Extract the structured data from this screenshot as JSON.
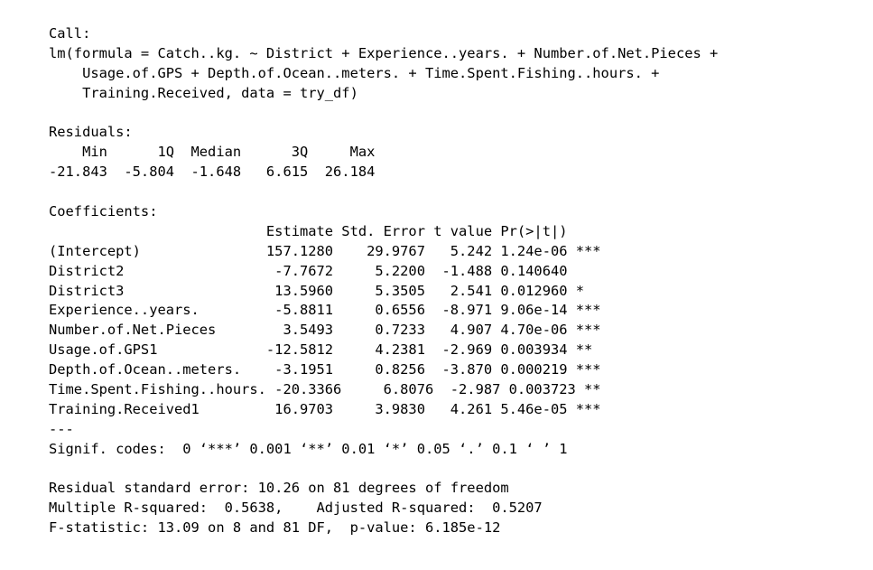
{
  "call": {
    "header": "Call:",
    "lines": [
      "lm(formula = Catch..kg. ~ District + Experience..years. + Number.of.Net.Pieces +",
      "    Usage.of.GPS + Depth.of.Ocean..meters. + Time.Spent.Fishing..hours. +",
      "    Training.Received, data = try_df)"
    ]
  },
  "residuals": {
    "header": "Residuals:",
    "labels_line": "    Min      1Q  Median      3Q     Max ",
    "values_line": "-21.843  -5.804  -1.648   6.615  26.184 "
  },
  "coefficients": {
    "header": "Coefficients:",
    "column_header_line": "                          Estimate Std. Error t value Pr(>|t|)    ",
    "rows": [
      "(Intercept)               157.1280    29.9767   5.242 1.24e-06 ***",
      "District2                  -7.7672     5.2200  -1.488 0.140640    ",
      "District3                  13.5960     5.3505   2.541 0.012960 *  ",
      "Experience..years.         -5.8811     0.6556  -8.971 9.06e-14 ***",
      "Number.of.Net.Pieces        3.5493     0.7233   4.907 4.70e-06 ***",
      "Usage.of.GPS1             -12.5812     4.2381  -2.969 0.003934 ** ",
      "Depth.of.Ocean..meters.    -3.1951     0.8256  -3.870 0.000219 ***",
      "Time.Spent.Fishing..hours. -20.3366     6.8076  -2.987 0.003723 ** ",
      "Training.Received1         16.9703     3.9830   4.261 5.46e-05 ***"
    ],
    "separator": "---",
    "signif_line": "Signif. codes:  0 ‘***’ 0.001 ‘**’ 0.01 ‘*’ 0.05 ‘.’ 0.1 ‘ ’ 1"
  },
  "summary": {
    "lines": [
      "Residual standard error: 10.26 on 81 degrees of freedom",
      "Multiple R-squared:  0.5638,\tAdjusted R-squared:  0.5207 ",
      "F-statistic: 13.09 on 8 and 81 DF,  p-value: 6.185e-12"
    ]
  }
}
